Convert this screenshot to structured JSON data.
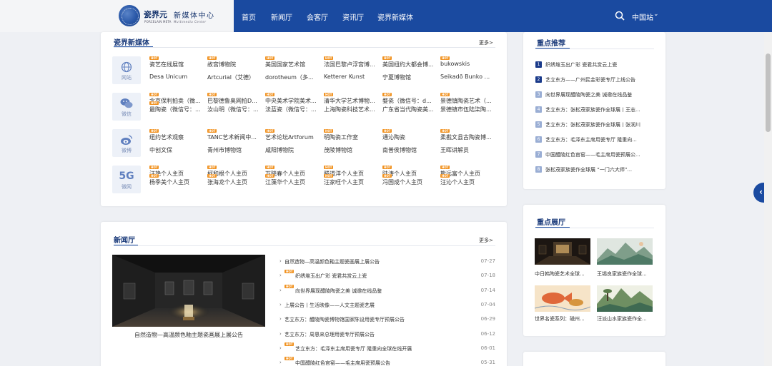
{
  "header": {
    "logo_cn": "瓷界元",
    "logo_en": "PORCELAIN META",
    "logo_sub_cn": "新媒体中心",
    "logo_sub_en": "Multimedia Center",
    "nav": [
      "首页",
      "新闻厅",
      "会客厅",
      "资讯厅",
      "瓷界新媒体"
    ],
    "region": "中国站"
  },
  "media": {
    "title": "瓷界新媒体",
    "more": "更多>",
    "hot": "HOT",
    "categories": [
      {
        "icon": "globe-icon",
        "label": "网站",
        "row1": [
          "瓷艺在线展馆",
          "故宫博物院",
          "美国国家艺术馆",
          "法国巴黎卢浮宫博...",
          "美国纽约大都会博...",
          "bukowskis"
        ],
        "row2": [
          "Desa Unicum",
          "Artcurial（艾德）",
          "dorotheum（多...",
          "Ketterer Kunst",
          "宁夏博物馆",
          "Seikadō Bunko ..."
        ]
      },
      {
        "icon": "wechat-icon",
        "label": "微信",
        "row1": [
          "北京保利拍卖（微...",
          "巴黎德鲁奥网拍D...",
          "中央美术学院美术...",
          "清华大学艺术博物...",
          "婺瓷（微信号：d...",
          "景德镇陶瓷艺术（..."
        ],
        "row2": [
          "最陶瓷（微信号：...",
          "汝山明（微信号：...",
          "法蓝瓷（微信号：...",
          "上海陶瓷科技艺术...",
          "广东省当代陶瓷美...",
          "景德镇市伍陆柒陶..."
        ]
      },
      {
        "icon": "weibo-icon",
        "label": "微博",
        "row1": [
          "纽约艺术观察",
          "TANC艺术新闻中...",
          "艺术论坛Artforum",
          "明陶瓷工作室",
          "通沁陶瓷",
          "柔戡文县古陶瓷博..."
        ],
        "row2": [
          "中创文保",
          "青州市博物馆",
          "咸阳博物院",
          "茂陵博物馆",
          "南普侯博物馆",
          "王晖讲解员"
        ]
      },
      {
        "icon": "5g-icon",
        "glyph": "5G",
        "label": "微网",
        "row1": [
          "汪艳个人主页",
          "柯和根个人主页",
          "万晓春个人主页",
          "滕道洋个人主页",
          "陆涛个人主页",
          "熊远富个人主页"
        ],
        "row2": [
          "杨季美个人主页",
          "张海龙个人主页",
          "江藻华个人主页",
          "汪家旺个人主页",
          "冯国成个人主页",
          "汪沁个人主页"
        ]
      }
    ]
  },
  "recommend": {
    "title": "重点推荐",
    "items": [
      {
        "num": "1",
        "text": "织绣堆玉出广彩 瓷君共赏云上瓷"
      },
      {
        "num": "2",
        "text": "艺立东方——广州民金彩瓷专厅上线公告"
      },
      {
        "num": "3",
        "text": "向世界展现醴陵陶瓷之美 诚邀在线品鉴"
      },
      {
        "num": "4",
        "text": "艺立东方：张松茂家族瓷作全球展丨王志..."
      },
      {
        "num": "5",
        "text": "艺立东方：张松茂家族瓷作全球展丨张润川"
      },
      {
        "num": "6",
        "text": "艺立东方：毛泽东主席用瓷专厅 隆重向..."
      },
      {
        "num": "7",
        "text": "中国醴陵红色官窑——毛主席用瓷预展公..."
      },
      {
        "num": "8",
        "text": "张松茂家族瓷作全球展 “一门六大师”..."
      }
    ],
    "colors": {
      "top": "#1a3a8a",
      "rest": "#9aaed4"
    }
  },
  "halls": {
    "title": "重点展厅",
    "items": [
      "中日韩陶瓷艺术全球...",
      "王锡良家族瓷作全球...",
      "世界名瓷系列：磁州...",
      "汪派山水家族瓷作全..."
    ]
  },
  "news": {
    "title": "新闻厅",
    "more": "更多>",
    "feature_caption": "自然造物—高温颜色釉主题瓷画展上展公告",
    "hot": "HOT",
    "items": [
      {
        "text": "自然造物—高温颜色釉主题瓷画展上展公告",
        "date": "07-27",
        "hot": false
      },
      {
        "text": "织绣堆玉出广彩 瓷君共赏云上瓷",
        "date": "07-18",
        "hot": true
      },
      {
        "text": "向世界展现醴陵陶瓷之美 诚邀在线品鉴",
        "date": "07-14",
        "hot": true
      },
      {
        "text": "上展公告丨生活映像——人文主题瓷艺展",
        "date": "07-04",
        "hot": false
      },
      {
        "text": "艺立东方：醴陵陶瓷博物馆国家陈设用瓷专厅预展公告",
        "date": "06-29",
        "hot": false
      },
      {
        "text": "艺立东方：周恩来总理用瓷专厅预展公告",
        "date": "06-12",
        "hot": false
      },
      {
        "text": "艺立东方：毛泽东主席用瓷专厅 隆重向全球在线开展",
        "date": "06-01",
        "hot": true
      },
      {
        "text": "中国醴陵红色官窑——毛主席用瓷预展公告",
        "date": "05-31",
        "hot": true
      }
    ]
  }
}
